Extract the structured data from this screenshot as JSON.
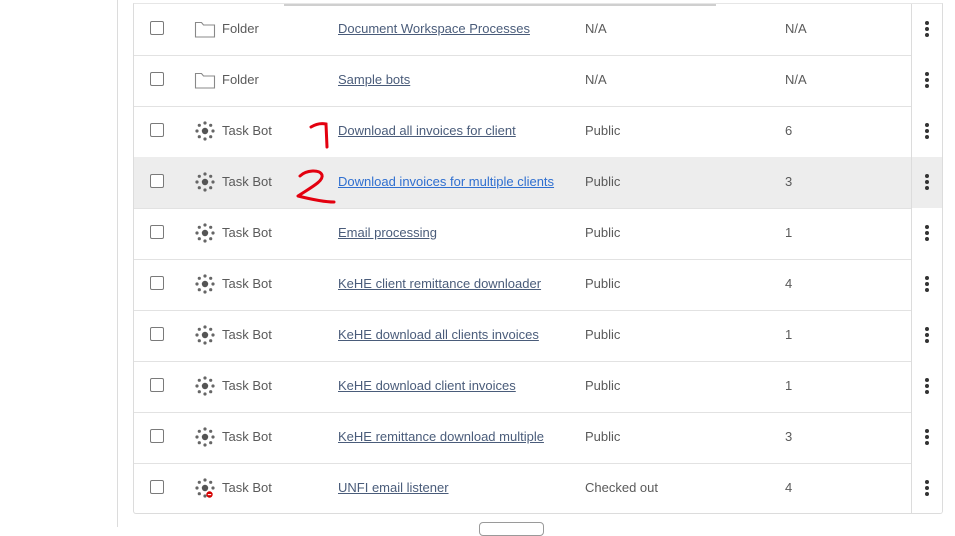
{
  "table": {
    "rows": [
      {
        "type": "Folder",
        "icon": "folder-icon",
        "name": "Document Workspace Processes",
        "access": "N/A",
        "count": "N/A"
      },
      {
        "type": "Folder",
        "icon": "folder-icon",
        "name": "Sample bots",
        "access": "N/A",
        "count": "N/A"
      },
      {
        "type": "Task Bot",
        "icon": "task-bot-icon",
        "name": "Download all invoices for client",
        "access": "Public",
        "count": "6"
      },
      {
        "type": "Task Bot",
        "icon": "task-bot-icon",
        "name": "Download invoices for multiple clients",
        "access": "Public",
        "count": "3"
      },
      {
        "type": "Task Bot",
        "icon": "task-bot-icon",
        "name": "Email processing",
        "access": "Public",
        "count": "1"
      },
      {
        "type": "Task Bot",
        "icon": "task-bot-icon",
        "name": "KeHE client remittance downloader",
        "access": "Public",
        "count": "4"
      },
      {
        "type": "Task Bot",
        "icon": "task-bot-icon",
        "name": "KeHE download all clients invoices",
        "access": "Public",
        "count": "1"
      },
      {
        "type": "Task Bot",
        "icon": "task-bot-icon",
        "name": "KeHE download client invoices",
        "access": "Public",
        "count": "1"
      },
      {
        "type": "Task Bot",
        "icon": "task-bot-icon",
        "name": "KeHE remittance download multiple",
        "access": "Public",
        "count": "3"
      },
      {
        "type": "Task Bot",
        "icon": "task-bot-icon",
        "name": "UNFI email listener",
        "access": "Checked out",
        "count": "4"
      }
    ]
  },
  "annotations": {
    "marks": [
      "1",
      "2"
    ],
    "color": "#e3000f"
  },
  "colors": {
    "link": "#4a5c7a",
    "link_active": "#2f6fd0",
    "row_highlight": "#ededed"
  }
}
